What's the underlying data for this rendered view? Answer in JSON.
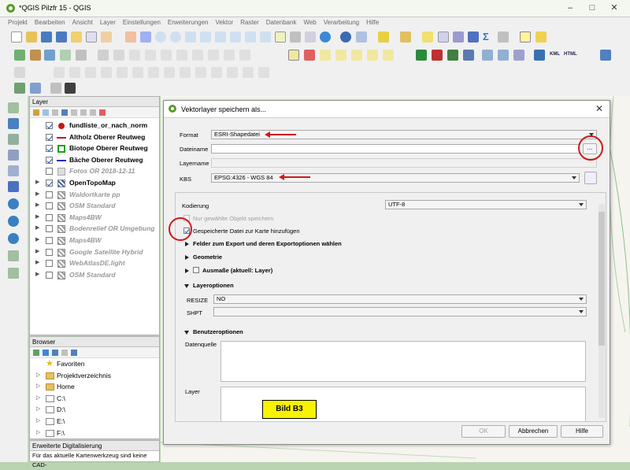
{
  "app": {
    "window_title": "*QGIS Pilzfr 15 - QGIS",
    "menu": [
      "Projekt",
      "Bearbeiten",
      "Ansicht",
      "Layer",
      "Einstellungen",
      "Erweiterungen",
      "Vektor",
      "Raster",
      "Datenbank",
      "Web",
      "Verarbeitung",
      "Hilfe"
    ],
    "toolbar_labels": {
      "kml": "KML",
      "html": "HTML"
    }
  },
  "layer_panel": {
    "title": "Layer",
    "layers": [
      {
        "name": "fundliste_or_nach_norm",
        "checked": true,
        "style": "bold",
        "symbol": "point",
        "color": "#c41a1a",
        "expand": ""
      },
      {
        "name": "Altholz Oberer Reutweg",
        "checked": true,
        "style": "bold",
        "symbol": "line",
        "color": "#c0142e",
        "expand": ""
      },
      {
        "name": "Biotope Oberer Reutweg",
        "checked": true,
        "style": "bold",
        "symbol": "polygon",
        "color": "#1aa21a",
        "expand": ""
      },
      {
        "name": "Bäche Oberer Reutweg",
        "checked": true,
        "style": "bold",
        "symbol": "line",
        "color": "#1a2ec0",
        "expand": ""
      },
      {
        "name": "Fotos OR 2018-12-11",
        "checked": false,
        "style": "italic",
        "symbol": "folder",
        "color": "#999999",
        "expand": ""
      },
      {
        "name": "OpenTopoMap",
        "checked": true,
        "style": "bold",
        "symbol": "tile",
        "color": "#2a5aa8",
        "expand": "▶"
      },
      {
        "name": "Waldortkarte pp",
        "checked": false,
        "style": "italic",
        "symbol": "tile",
        "color": "#999999",
        "expand": "▶"
      },
      {
        "name": "OSM Standard",
        "checked": false,
        "style": "italic",
        "symbol": "tile",
        "color": "#999999",
        "expand": "▶"
      },
      {
        "name": "Maps4BW",
        "checked": false,
        "style": "italic",
        "symbol": "tile",
        "color": "#999999",
        "expand": "▶"
      },
      {
        "name": "Bodenrelief OR Umgebung",
        "checked": false,
        "style": "italic",
        "symbol": "tile",
        "color": "#999999",
        "expand": "▶"
      },
      {
        "name": "Maps4BW",
        "checked": false,
        "style": "italic",
        "symbol": "tile",
        "color": "#999999",
        "expand": "▶"
      },
      {
        "name": "Google Satellite Hybrid",
        "checked": false,
        "style": "italic",
        "symbol": "tile",
        "color": "#999999",
        "expand": "▶"
      },
      {
        "name": "WebAtlasDE.light",
        "checked": false,
        "style": "italic",
        "symbol": "tile",
        "color": "#999999",
        "expand": "▶"
      },
      {
        "name": "OSM Standard",
        "checked": false,
        "style": "italic",
        "symbol": "tile",
        "color": "#999999",
        "expand": "▶"
      }
    ]
  },
  "browser_panel": {
    "title": "Browser",
    "items": [
      {
        "name": "Favoriten",
        "icon": "star-icon",
        "expand": ""
      },
      {
        "name": "Projektverzeichnis",
        "icon": "folder-icon",
        "expand": "▷"
      },
      {
        "name": "Home",
        "icon": "folder-icon",
        "expand": "▷"
      },
      {
        "name": "C:\\",
        "icon": "drive-icon",
        "expand": "▷"
      },
      {
        "name": "D:\\",
        "icon": "drive-icon",
        "expand": "▷"
      },
      {
        "name": "E:\\",
        "icon": "drive-icon",
        "expand": "▷"
      },
      {
        "name": "F:\\",
        "icon": "drive-icon",
        "expand": "▷"
      }
    ]
  },
  "digitizing_panel": {
    "title": "Erweiterte Digitalisierung",
    "text": "Für das aktuelle Kartenwerkzeug sind keine CAD-"
  },
  "dialog": {
    "title": "Vektorlayer speichern als...",
    "format_label": "Format",
    "format_value": "ESRI-Shapedatei",
    "filename_label": "Dateiname",
    "filename_value": "",
    "browse_label": "...",
    "layername_label": "Layername",
    "crs_label": "KBS",
    "crs_value": "EPSG:4326 - WGS 84",
    "encoding_label": "Kodierung",
    "encoding_value": "UTF-8",
    "only_selected_label": "Nur gewählte Objekt speichern",
    "add_to_map_label": "Gespeicherte Datei zur Karte hinzufügen",
    "fields_section": "Felder zum Export und deren Exportoptionen wählen",
    "geometry_section": "Geometrie",
    "extent_section": "Ausmaße (aktuell: Layer)",
    "layer_options_section": "Layeroptionen",
    "resize_label": "RESIZE",
    "resize_value": "NO",
    "shpt_label": "SHPT",
    "shpt_value": "",
    "custom_options_section": "Benutzeroptionen",
    "datasource_label": "Datenquelle",
    "layer_label": "Layer",
    "ok_label": "OK",
    "cancel_label": "Abbrechen",
    "help_label": "Hilfe"
  },
  "annotation": {
    "label": "Bild B3"
  }
}
